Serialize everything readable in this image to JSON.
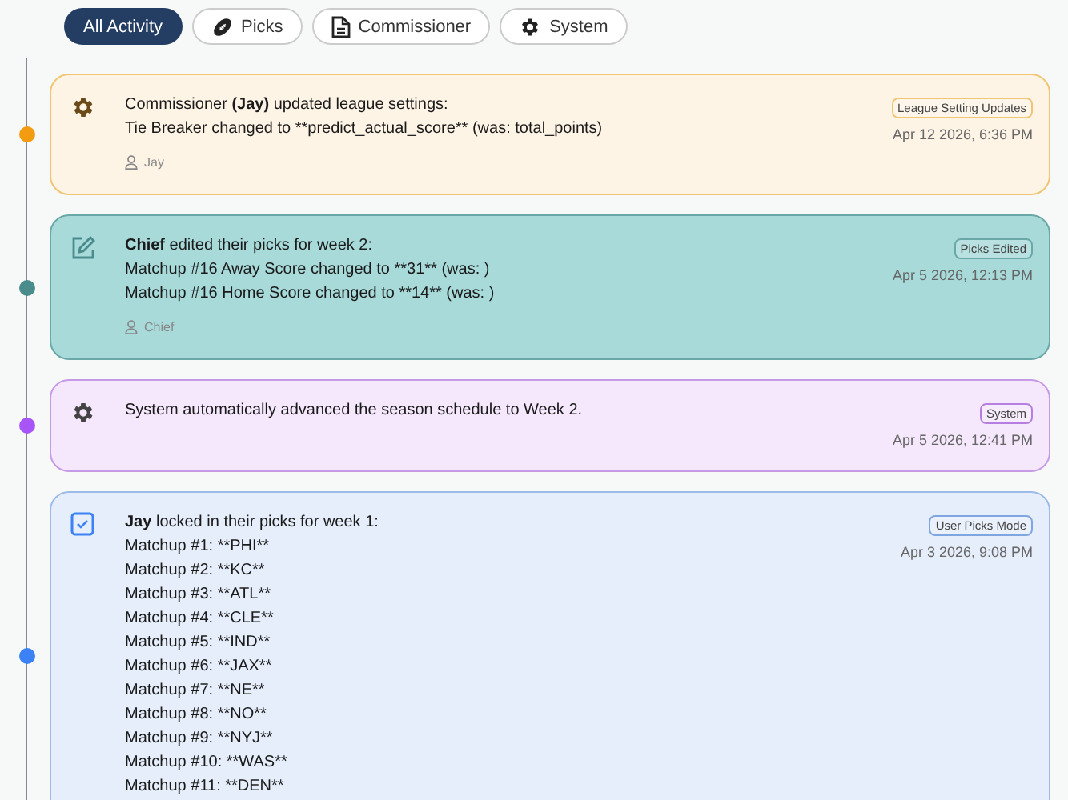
{
  "filters": [
    {
      "label": "All Activity",
      "kind": "all",
      "selected": true
    },
    {
      "label": "Picks",
      "kind": "picks",
      "selected": false
    },
    {
      "label": "Commissioner",
      "kind": "commissioner",
      "selected": false
    },
    {
      "label": "System",
      "kind": "system",
      "selected": false
    }
  ],
  "events": [
    {
      "kind": "settings",
      "color": "#f39c12",
      "headline": "Commissioner **(Jay)** updated league settings:",
      "details": [
        "Tie Breaker changed to **predict_actual_score** (was: total_points)"
      ],
      "user": "Jay",
      "tag": "League Setting Updates",
      "time": "Apr 12 2026, 6:36 PM"
    },
    {
      "kind": "picks_edited",
      "color": "#4a8c8c",
      "headline": "**Chief** edited their picks for week 2:",
      "details": [
        "Matchup #16 Away Score changed to **31** (was: )",
        "Matchup #16 Home Score changed to **14** (was: )"
      ],
      "user": "Chief",
      "tag": "Picks Edited",
      "time": "Apr 5 2026, 12:13 PM"
    },
    {
      "kind": "system",
      "color": "#a855f7",
      "headline": "System automatically advanced the season schedule to Week 2.",
      "tag": "System",
      "time": "Apr 5 2026, 12:41 PM"
    },
    {
      "kind": "picks_locked",
      "color": "#3b82f6",
      "headline": "**Jay** locked in their picks for week 1:",
      "details": [
        "Matchup #1: **PHI**",
        "Matchup #2: **KC**",
        "Matchup #3: **ATL**",
        "Matchup #4: **CLE**",
        "Matchup #5: **IND**",
        "Matchup #6: **JAX**",
        "Matchup #7: **NE**",
        "Matchup #8: **NO**",
        "Matchup #9: **NYJ**",
        "Matchup #10: **WAS**",
        "Matchup #11: **DEN**"
      ],
      "tag": "User Picks Mode",
      "time": "Apr 3 2026, 9:08 PM"
    }
  ]
}
